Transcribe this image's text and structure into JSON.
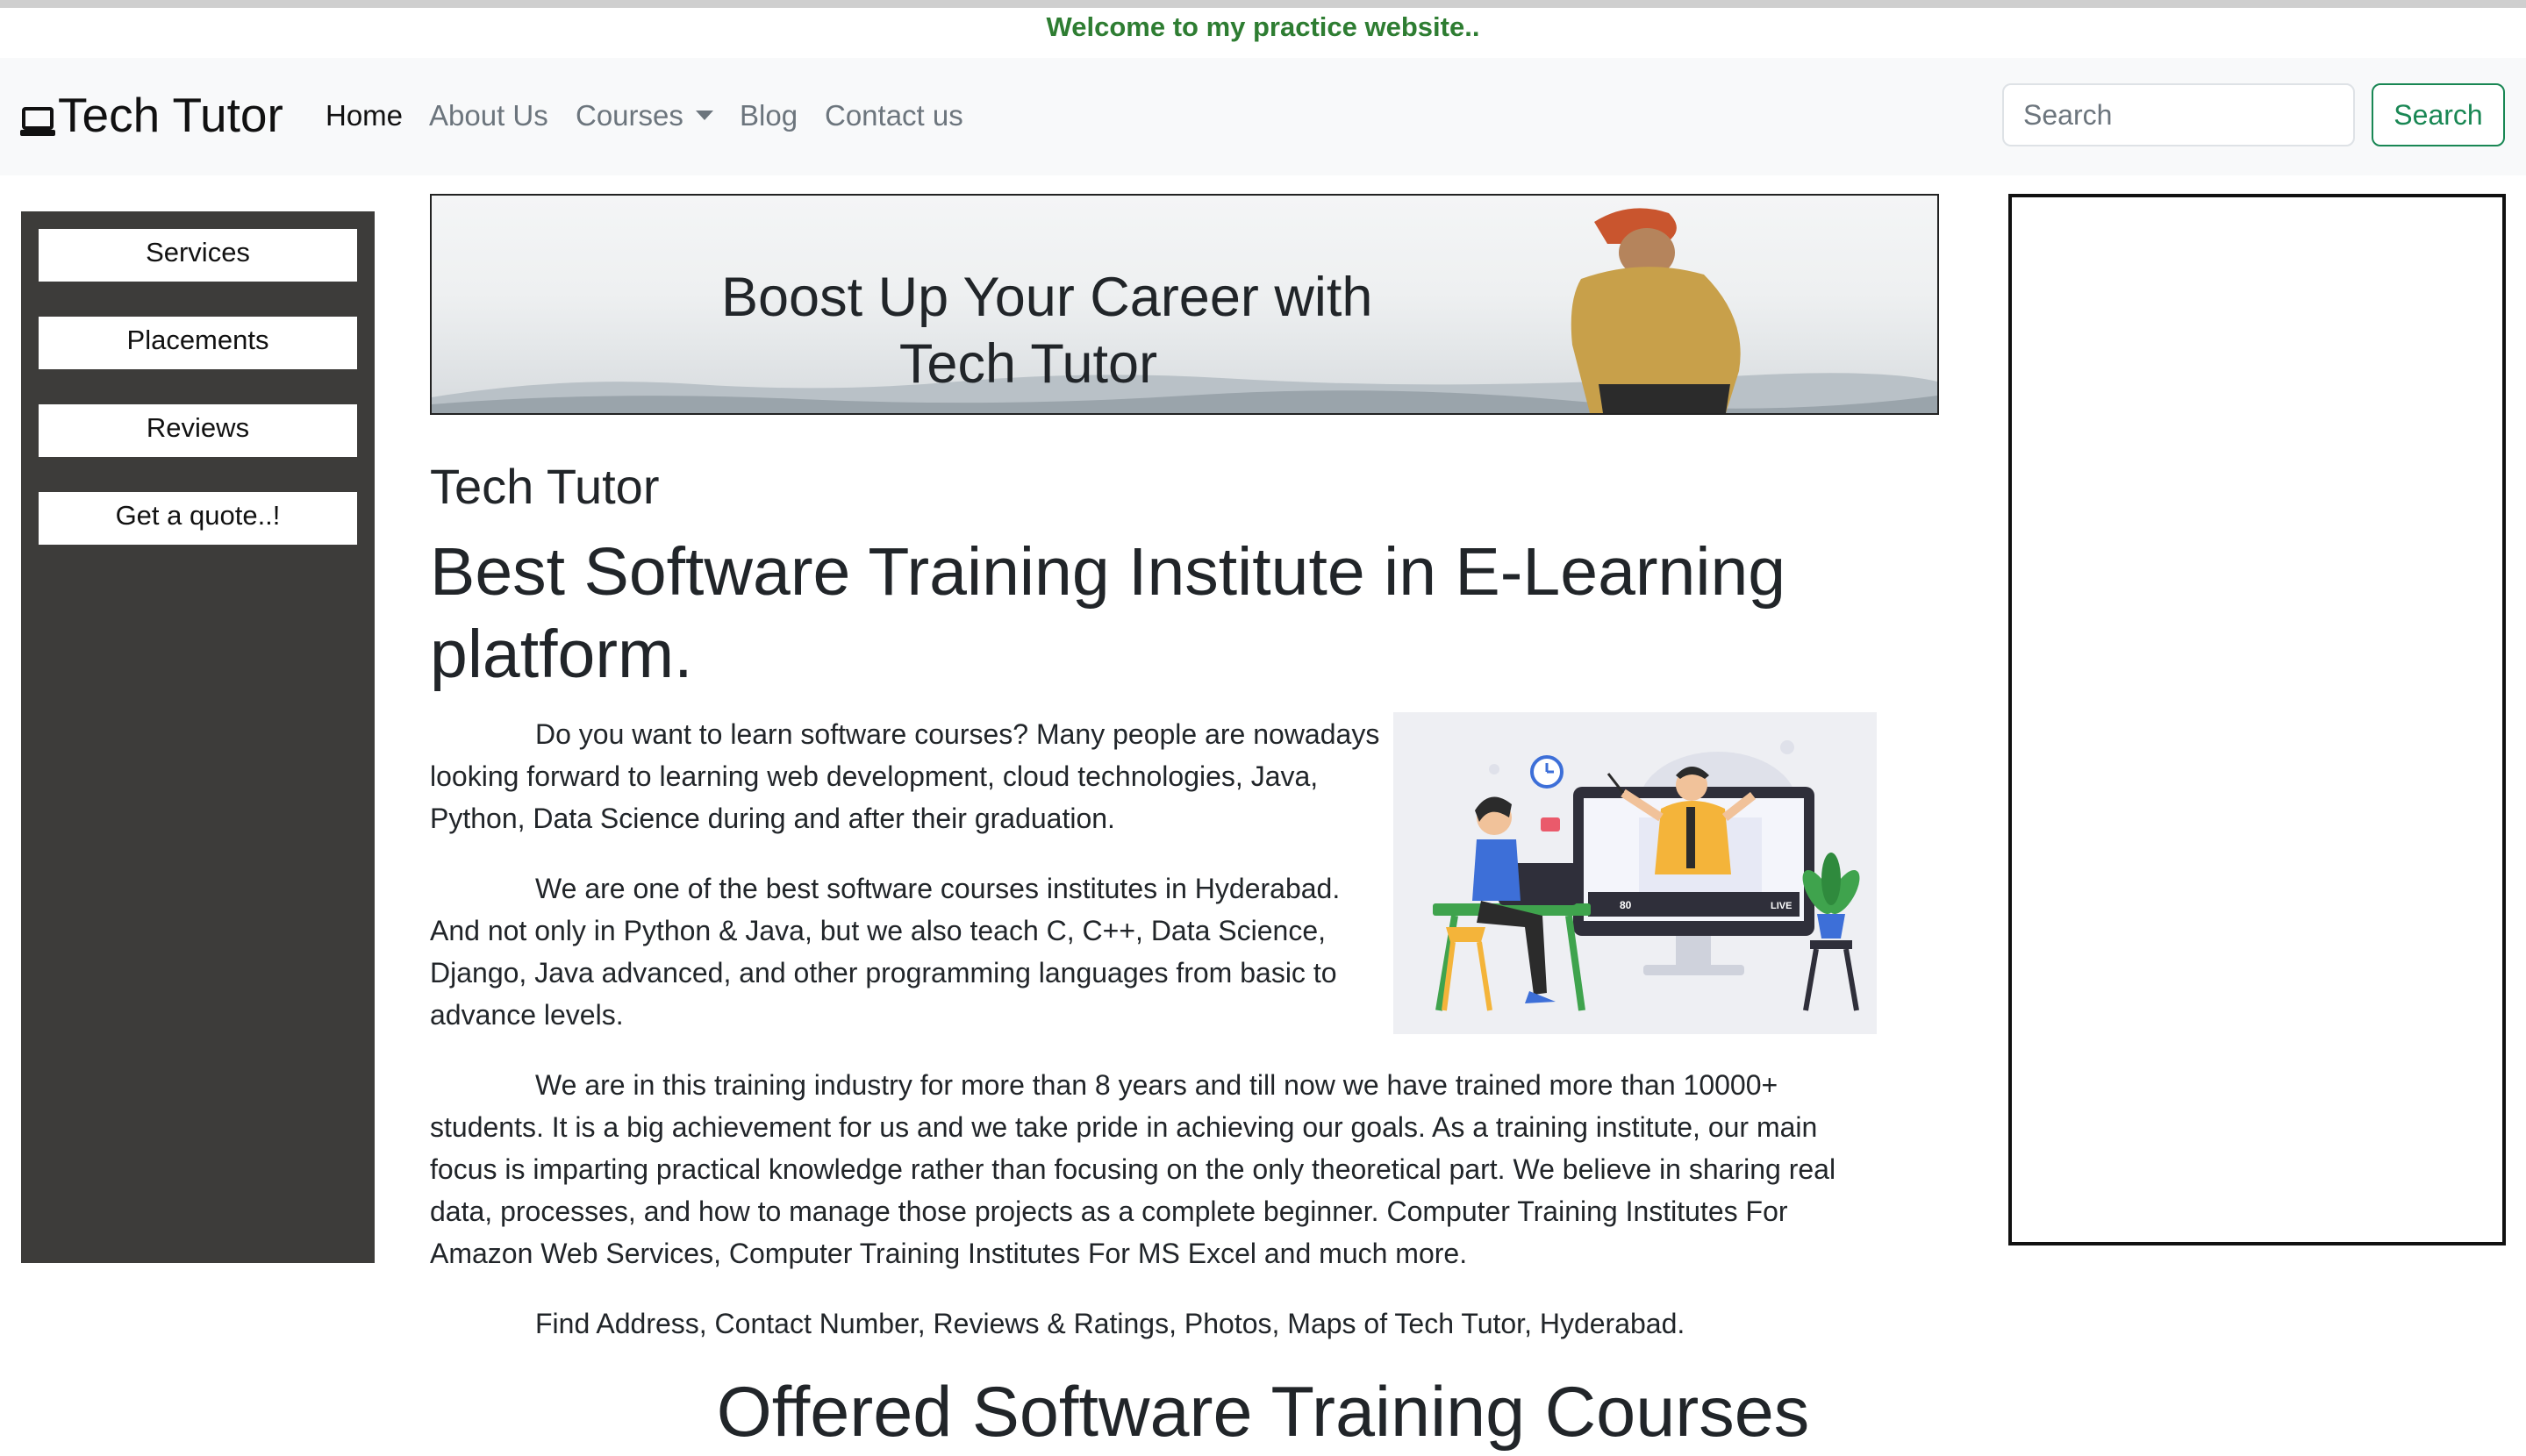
{
  "welcome": "Welcome to my practice website..",
  "navbar": {
    "brand": "Tech Tutor",
    "brand_icon": "laptop-icon",
    "links": [
      "Home",
      "About Us",
      "Courses",
      "Blog",
      "Contact us"
    ],
    "search_placeholder": "Search",
    "search_button": "Search"
  },
  "sidebar": {
    "items": [
      "Services",
      "Placements",
      "Reviews",
      "Get a quote..!"
    ]
  },
  "banner": {
    "line1": "Boost Up Your Career with",
    "line2": "Tech Tutor"
  },
  "main": {
    "subtitle": "Tech Tutor",
    "headline": "Best Software Training Institute in E-Learning platform.",
    "paragraphs": [
      "Do you want to learn software courses? Many people are nowadays looking forward to learning web development, cloud technologies, Java, Python, Data Science during and after their graduation.",
      "We are one of the best software courses institutes in Hyderabad. And not only in Python & Java, but we also teach C, C++, Data Science, Django, Java advanced, and other programming languages from basic to advance levels.",
      "We are in this training industry for more than 8 years and till now we have trained more than 10000+ students. It is a big achievement for us and we take pride in achieving our goals. As a training institute, our main focus is imparting practical knowledge rather than focusing on the only theoretical part. We believe in sharing real data, processes, and how to manage those projects as a complete beginner. Computer Training Institutes For Amazon Web Services, Computer Training Institutes For MS Excel and much more.",
      "Find Address, Contact Number, Reviews & Ratings, Photos, Maps of Tech Tutor, Hyderabad."
    ],
    "illustration_screen": {
      "count": "80",
      "live": "LIVE"
    },
    "courses_heading": "Offered Software Training Courses"
  },
  "colors": {
    "welcome": "#2e7d32",
    "navbar_bg": "#f8f9fa",
    "sidebar_bg": "#3d3c3a",
    "search_button": "#198754"
  }
}
